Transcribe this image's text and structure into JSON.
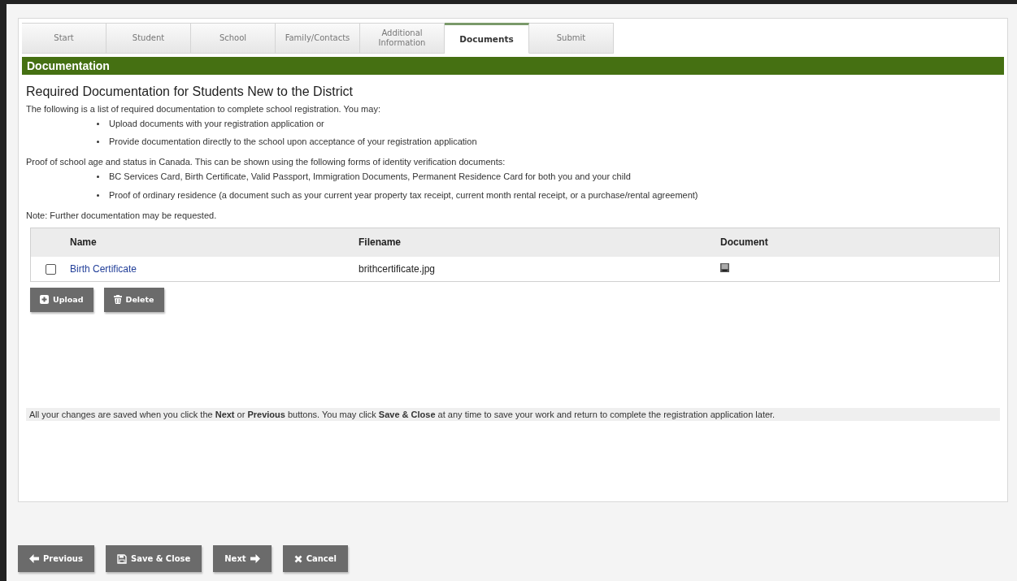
{
  "tabs": [
    {
      "label": "Start",
      "selected": false
    },
    {
      "label": "Student",
      "selected": false
    },
    {
      "label": "School",
      "selected": false
    },
    {
      "label": "Family/Contacts",
      "selected": false
    },
    {
      "label": "Additional Information",
      "selected": false
    },
    {
      "label": "Documents",
      "selected": true
    },
    {
      "label": "Submit",
      "selected": false
    }
  ],
  "section_title": "Documentation",
  "heading": "Required Documentation for Students New to the District",
  "intro": "The following is a list of required documentation to complete school registration. You may:",
  "intro_bullets": [
    "Upload documents with your registration application or",
    "Provide documentation directly to the school upon acceptance of your registration application"
  ],
  "proof": "Proof of school age and status in Canada. This can be shown using the following forms of identity verification documents:",
  "proof_bullets": [
    "BC Services Card, Birth Certificate, Valid Passport, Immigration Documents, Permanent Residence Card for both you and your child",
    "Proof of ordinary residence (a document such as your current year property tax receipt, current month rental receipt, or a purchase/rental agreement)"
  ],
  "note": "Note: Further documentation may be requested.",
  "table": {
    "columns": [
      "Name",
      "Filename",
      "Document"
    ],
    "rows": [
      {
        "checked": false,
        "name": "Birth Certificate",
        "filename": "brithcertificate.jpg"
      }
    ]
  },
  "table_buttons": [
    {
      "kind": "upload",
      "label": "Upload"
    },
    {
      "kind": "delete",
      "label": "Delete"
    }
  ],
  "footer_note": "All your changes are saved when you click the **Next** or **Previous** buttons. You may click **Save & Close** at any time to save your work and return to complete the registration application later.",
  "nav_buttons": [
    {
      "kind": "previous",
      "label": "Previous"
    },
    {
      "kind": "save",
      "label": "Save & Close"
    },
    {
      "kind": "next",
      "label": "Next"
    },
    {
      "kind": "cancel",
      "label": "Cancel"
    }
  ]
}
